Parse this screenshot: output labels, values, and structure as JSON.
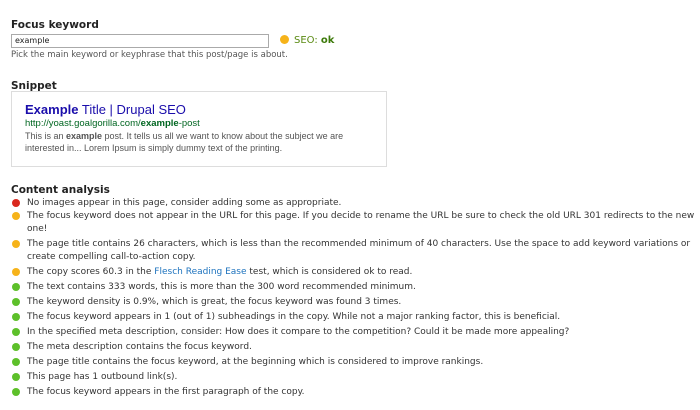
{
  "focus_keyword": {
    "heading": "Focus keyword",
    "value": "example",
    "help": "Pick the main keyword or keyphrase that this post/page is about.",
    "seo_label": "SEO:",
    "seo_value": "ok"
  },
  "snippet": {
    "heading": "Snippet",
    "title_keyword": "Example",
    "title_rest": " Title | Drupal SEO",
    "url_prefix": "http://yoast.goalgorilla.com/",
    "url_keyword": "example",
    "url_suffix": "-post",
    "desc_prefix": "This is an ",
    "desc_keyword": "example",
    "desc_rest": " post. It tells us all we want to know about the subject we are interested in... Lorem Ipsum is simply dummy text of the printing."
  },
  "content_analysis": {
    "heading": "Content analysis",
    "items": [
      {
        "status": "red",
        "text": "No images appear in this page, consider adding some as appropriate."
      },
      {
        "status": "orange",
        "text": "The focus keyword does not appear in the URL for this page. If you decide to rename the URL be sure to check the old URL 301 redirects to the new one!"
      },
      {
        "status": "orange",
        "text": "The page title contains 26 characters, which is less than the recommended minimum of 40 characters. Use the space to add keyword variations or create compelling call-to-action copy."
      },
      {
        "status": "orange",
        "text_before": "The copy scores 60.3 in the ",
        "link": "Flesch Reading Ease",
        "text_after": " test, which is considered ok to read."
      },
      {
        "status": "green",
        "text": "The text contains 333 words, this is more than the 300 word recommended minimum."
      },
      {
        "status": "green",
        "text": "The keyword density is 0.9%, which is great, the focus keyword was found 3 times."
      },
      {
        "status": "green",
        "text": "The focus keyword appears in 1 (out of 1) subheadings in the copy. While not a major ranking factor, this is beneficial."
      },
      {
        "status": "green",
        "text": "In the specified meta description, consider: How does it compare to the competition? Could it be made more appealing?"
      },
      {
        "status": "green",
        "text": "The meta description contains the focus keyword."
      },
      {
        "status": "green",
        "text": "The page title contains the focus keyword, at the beginning which is considered to improve rankings."
      },
      {
        "status": "green",
        "text": "This page has 1 outbound link(s)."
      },
      {
        "status": "green",
        "text": "The focus keyword appears in the first paragraph of the copy."
      }
    ]
  },
  "colors": {
    "red": "#d9281e",
    "orange": "#f6b31a",
    "green": "#5dc02a",
    "link": "#1e73be",
    "snippet_title": "#1a0dab",
    "snippet_url": "#006621"
  }
}
